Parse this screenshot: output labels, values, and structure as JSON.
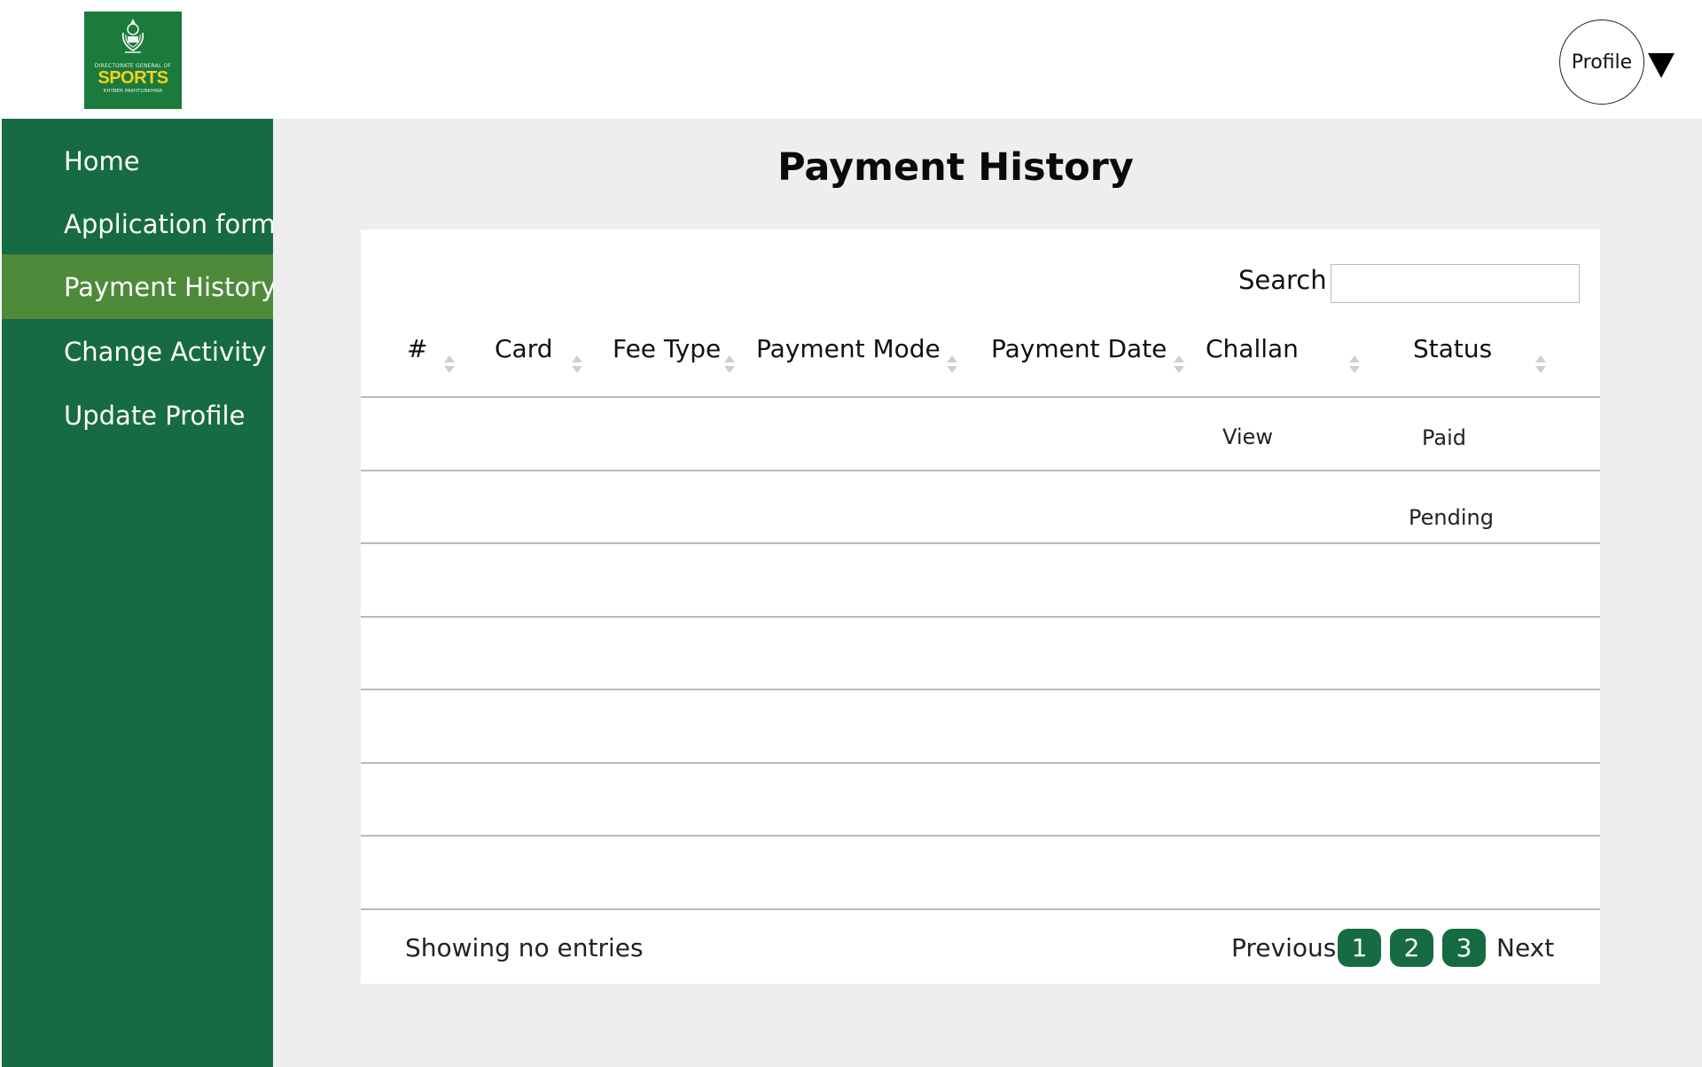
{
  "brand": {
    "logo_line1": "DIRECTORATE GENERAL OF",
    "logo_title": "SPORTS",
    "logo_line3": "KHYBER PAKHTUNKHWA",
    "primary_color": "#176b42",
    "active_color": "#4d8a3a",
    "logo_text_color": "#f3d21c"
  },
  "header": {
    "profile_label": "Profile"
  },
  "sidebar": {
    "items": [
      {
        "label": "Home"
      },
      {
        "label": "Application form"
      },
      {
        "label": "Payment History",
        "active": true
      },
      {
        "label": "Change Activity"
      },
      {
        "label": "Update Profile"
      }
    ]
  },
  "page": {
    "title": "Payment History"
  },
  "search": {
    "label": "Search",
    "value": ""
  },
  "table": {
    "columns": [
      "#",
      "Card",
      "Fee Type",
      "Payment Mode",
      "Payment Date",
      "Challan",
      "Status"
    ],
    "rows": [
      {
        "challan": "View",
        "status": "Paid"
      },
      {
        "challan": "",
        "status": "Pending"
      },
      {
        "challan": "",
        "status": ""
      },
      {
        "challan": "",
        "status": ""
      },
      {
        "challan": "",
        "status": ""
      },
      {
        "challan": "",
        "status": ""
      },
      {
        "challan": "",
        "status": ""
      }
    ]
  },
  "footer": {
    "info": "Showing no entries",
    "previous": "Previous",
    "pages": [
      "1",
      "2",
      "3"
    ],
    "next": "Next"
  }
}
